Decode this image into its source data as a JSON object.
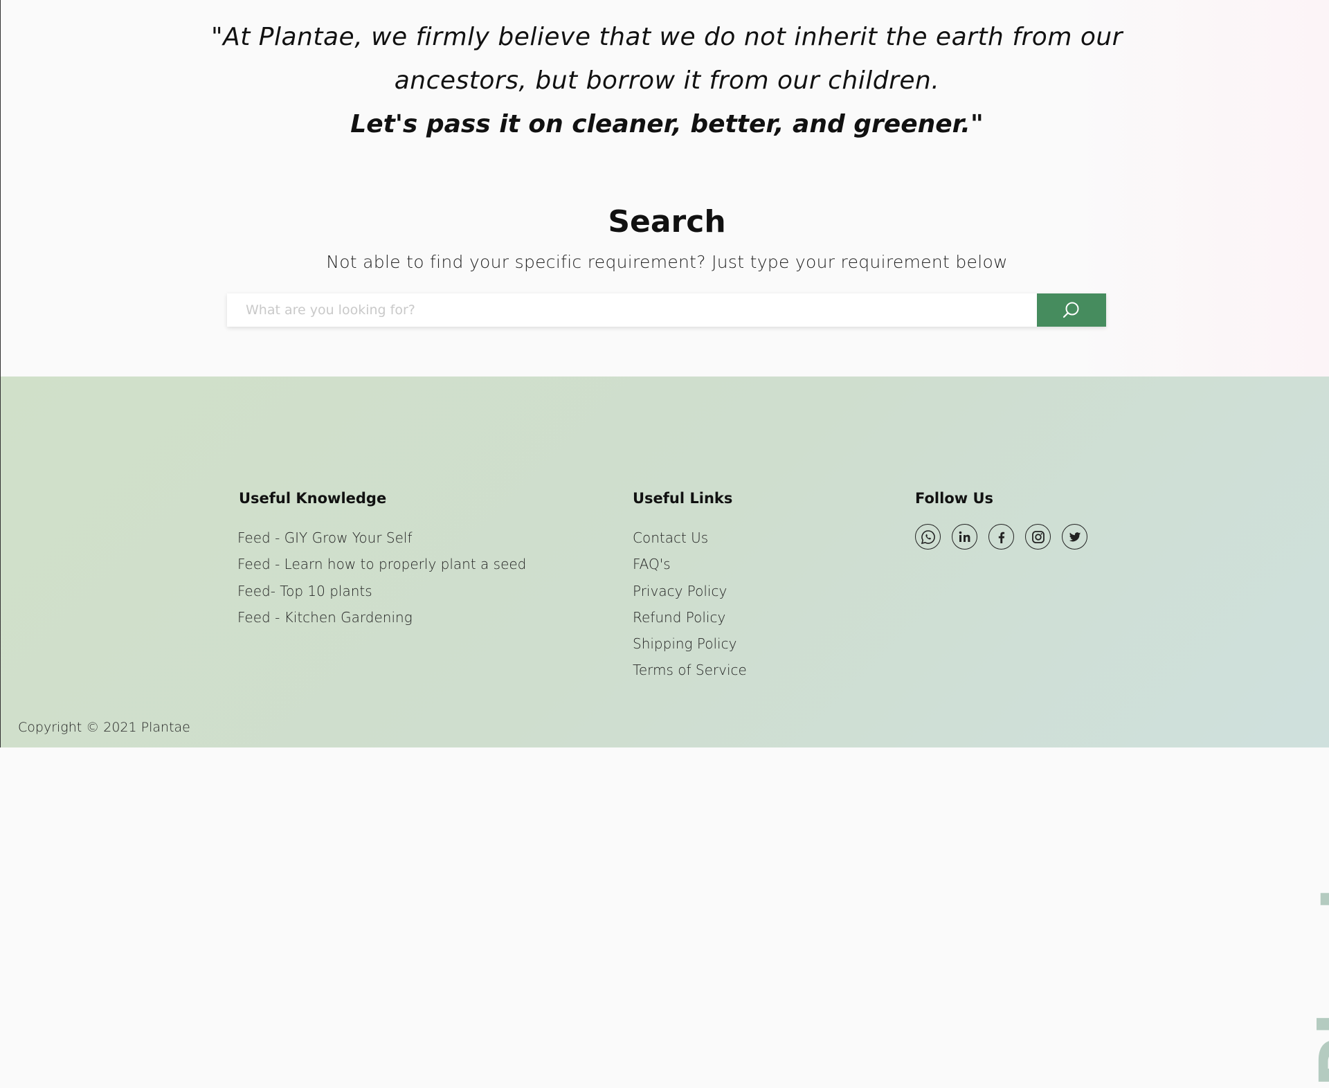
{
  "quote": {
    "line1": "\"At Plantae, we firmly believe that we do not inherit the earth from our",
    "line2": "ancestors, but borrow it from our children.",
    "line3": "Let's pass it on cleaner, better, and greener.\""
  },
  "search": {
    "title": "Search",
    "subtitle": "Not able to find your specific requirement? Just type your requirement below",
    "placeholder": "What are you looking for?",
    "button_icon": "search-icon",
    "button_color": "#468c5e"
  },
  "footer": {
    "useful_knowledge": {
      "title": "Useful Knowledge",
      "links": [
        "Feed - GIY Grow Your Self",
        "Feed - Learn how to properly plant a seed",
        "Feed- Top 10 plants",
        "Feed - Kitchen Gardening"
      ]
    },
    "useful_links": {
      "title": "Useful Links",
      "links": [
        "Contact Us",
        "FAQ's",
        "Privacy Policy",
        "Refund Policy",
        "Shipping Policy",
        "Terms of Service"
      ]
    },
    "follow_us": {
      "title": "Follow Us",
      "icons": [
        "whatsapp-icon",
        "linkedin-icon",
        "facebook-icon",
        "instagram-icon",
        "twitter-icon"
      ]
    },
    "brand": "Plantae.",
    "copyright": "Copyright © 2021 Plantae",
    "bg_color": "#d0e0c9"
  }
}
